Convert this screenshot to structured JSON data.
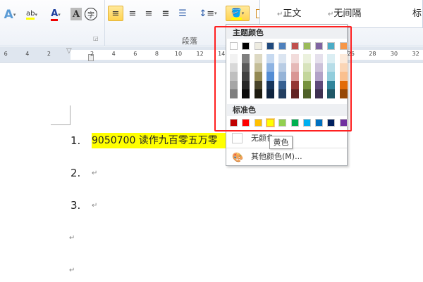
{
  "ribbon": {
    "group_label": "段落",
    "styles": [
      "正文",
      "无间隔",
      "标"
    ],
    "return_glyph": "↵",
    "icons": [
      "text-effects-icon",
      "highlight-icon",
      "font-color-icon",
      "char-shading-icon",
      "enclose-char-icon",
      "align-left-icon",
      "align-center-icon",
      "align-right-icon",
      "justify-icon",
      "distributed-icon",
      "line-spacing-icon",
      "shading-icon",
      "border-icon"
    ]
  },
  "ruler": {
    "labels": [
      "6",
      "4",
      "2",
      "2",
      "4",
      "6",
      "8",
      "10",
      "12",
      "14",
      "26",
      "28",
      "30",
      "32"
    ]
  },
  "color_menu": {
    "theme_title": "主题颜色",
    "standard_title": "标准色",
    "no_color": "无颜色",
    "more_colors": "其他颜色(M)...",
    "tooltip": "黄色",
    "selected": "#ffff00",
    "theme_colors": [
      "#ffffff",
      "#000000",
      "#eeece1",
      "#1f497d",
      "#4f81bd",
      "#c0504d",
      "#9bbb59",
      "#8064a2",
      "#4bacc6",
      "#f79646"
    ],
    "theme_shades": [
      [
        "#f2f2f2",
        "#d8d8d8",
        "#bfbfbf",
        "#a5a5a5",
        "#7f7f7f"
      ],
      [
        "#7f7f7f",
        "#595959",
        "#3f3f3f",
        "#262626",
        "#0c0c0c"
      ],
      [
        "#ddd9c3",
        "#c4bd97",
        "#938953",
        "#494429",
        "#1d1b10"
      ],
      [
        "#c6d9f0",
        "#8db3e2",
        "#548dd4",
        "#17365d",
        "#0f243e"
      ],
      [
        "#dbe5f1",
        "#b8cce4",
        "#95b3d7",
        "#366092",
        "#244061"
      ],
      [
        "#f2dcdb",
        "#e5b9b7",
        "#d99694",
        "#953734",
        "#632423"
      ],
      [
        "#ebf1dd",
        "#d7e3bc",
        "#c3d69b",
        "#76923c",
        "#4f6128"
      ],
      [
        "#e5e0ec",
        "#ccc1d9",
        "#b2a2c7",
        "#5f497a",
        "#3f3151"
      ],
      [
        "#dbeef3",
        "#b7dde8",
        "#92cddc",
        "#31859b",
        "#205867"
      ],
      [
        "#fdeada",
        "#fbd5b5",
        "#fac08f",
        "#e36c09",
        "#974806"
      ]
    ],
    "standard_colors": [
      "#c00000",
      "#ff0000",
      "#ffc000",
      "#ffff00",
      "#92d050",
      "#00b050",
      "#00b0f0",
      "#0070c0",
      "#002060",
      "#7030a0"
    ]
  },
  "document": {
    "list": [
      {
        "num": "1.",
        "text": "9050700 读作九百零五万零"
      },
      {
        "num": "2."
      },
      {
        "num": "3."
      }
    ],
    "highlight": "#ffff00"
  }
}
